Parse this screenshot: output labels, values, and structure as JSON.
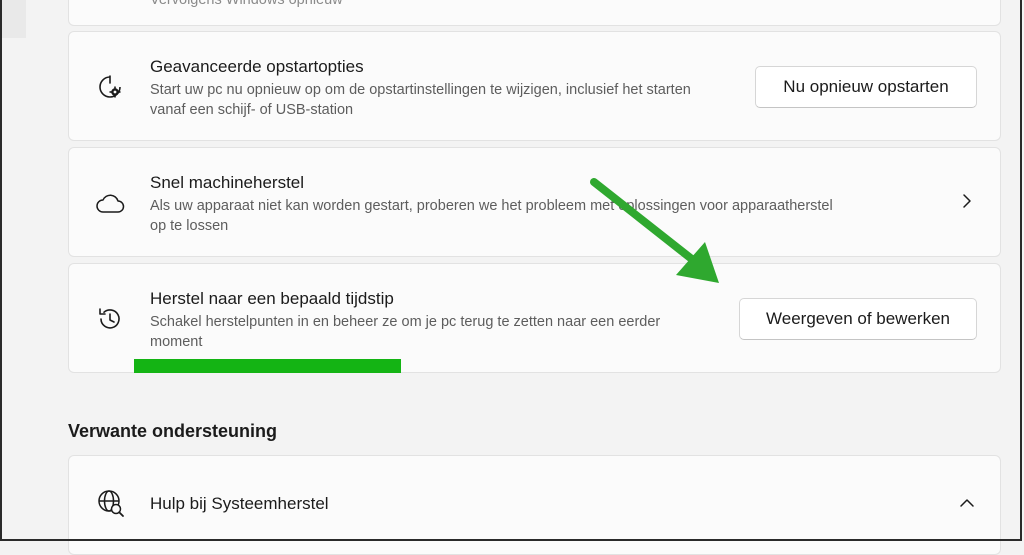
{
  "top_partial_desc": "Vervolgens Windows opnieuw",
  "cards": [
    {
      "title": "Geavanceerde opstartopties",
      "desc": "Start uw pc nu opnieuw op om de opstartinstellingen te wijzigen, inclusief het starten vanaf een schijf- of USB-station",
      "button": "Nu opnieuw opstarten",
      "icon": "startup-gear-icon"
    },
    {
      "title": "Snel machineherstel",
      "desc": "Als uw apparaat niet kan worden gestart, proberen we het probleem met oplossingen voor apparaatherstel op te lossen",
      "icon": "cloud-icon"
    },
    {
      "title": "Herstel naar een bepaald tijdstip",
      "desc": "Schakel herstelpunten in en beheer ze om je pc terug te zetten naar een eerder moment",
      "button": "Weergeven of bewerken",
      "icon": "history-clock-icon"
    }
  ],
  "related": {
    "heading": "Verwante ondersteuning",
    "item_label": "Hulp bij Systeemherstel",
    "item_icon": "globe-search-icon"
  },
  "annotation_colors": {
    "arrow": "#2fa82f",
    "underline": "#14b414"
  }
}
